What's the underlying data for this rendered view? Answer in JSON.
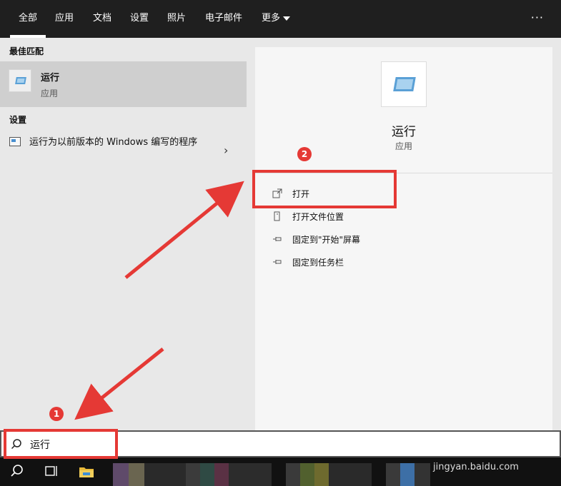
{
  "tabs": [
    {
      "label": "全部"
    },
    {
      "label": "应用"
    },
    {
      "label": "文档"
    },
    {
      "label": "设置"
    },
    {
      "label": "照片"
    },
    {
      "label": "电子邮件"
    },
    {
      "label": "更多"
    }
  ],
  "more_menu_label": "···",
  "left": {
    "best_match_title": "最佳匹配",
    "best_match": {
      "title": "运行",
      "subtitle": "应用"
    },
    "settings_title": "设置",
    "settings_item": "运行为以前版本的 Windows 编写的程序"
  },
  "right": {
    "app_title": "运行",
    "app_subtitle": "应用",
    "actions": [
      {
        "label": "打开",
        "icon": "open-icon"
      },
      {
        "label": "打开文件位置",
        "icon": "file-location-icon"
      },
      {
        "label": "固定到\"开始\"屏幕",
        "icon": "pin-icon"
      },
      {
        "label": "固定到任务栏",
        "icon": "pin-icon"
      }
    ]
  },
  "search": {
    "value": "运行"
  },
  "annotations": [
    {
      "label": "1"
    },
    {
      "label": "2"
    }
  ],
  "watermark": "jingyan.baidu.com",
  "colors": {
    "annotation": "#e53935",
    "topbar": "#1f1f1f",
    "accent_icon": "#5aa0d6"
  }
}
